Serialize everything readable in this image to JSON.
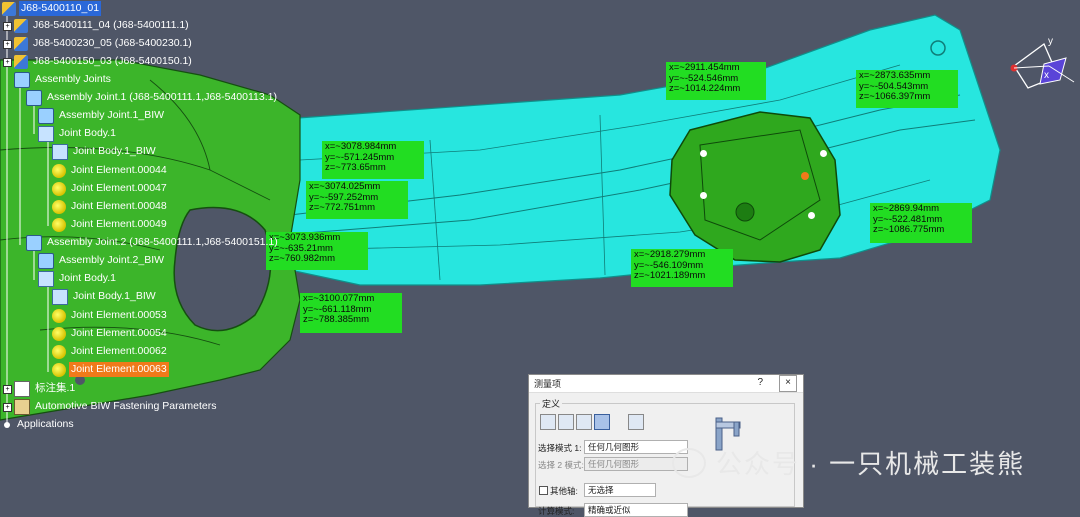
{
  "tree": {
    "root": "J68-5400110_01",
    "items": [
      {
        "label": "J68-5400111_04 (J68-5400111.1)"
      },
      {
        "label": "J68-5400230_05 (J68-5400230.1)"
      },
      {
        "label": "J68-5400150_03 (J68-5400150.1)"
      },
      {
        "label": "Assembly Joints"
      },
      {
        "label": "Assembly Joint.1 (J68-5400111.1,J68-5400113.1)"
      },
      {
        "label": "Assembly Joint.1_BIW"
      },
      {
        "label": "Joint Body.1"
      },
      {
        "label": "Joint Body.1_BIW"
      },
      {
        "label": "Joint Element.00044"
      },
      {
        "label": "Joint Element.00047"
      },
      {
        "label": "Joint Element.00048"
      },
      {
        "label": "Joint Element.00049"
      },
      {
        "label": "Assembly Joint.2 (J68-5400111.1,J68-5400151.1)"
      },
      {
        "label": "Assembly Joint.2_BIW"
      },
      {
        "label": "Joint Body.1"
      },
      {
        "label": "Joint Body.1_BIW"
      },
      {
        "label": "Joint Element.00053"
      },
      {
        "label": "Joint Element.00054"
      },
      {
        "label": "Joint Element.00062"
      },
      {
        "label": "Joint Element.00063"
      },
      {
        "label": "标注集.1"
      },
      {
        "label": "Automotive BIW Fastening Parameters"
      },
      {
        "label": "Applications"
      }
    ]
  },
  "measurements": [
    {
      "x": "x=~2911.454mm",
      "y": "y=~-524.546mm",
      "z": "z=~1014.224mm"
    },
    {
      "x": "x=~2873.635mm",
      "y": "y=~-504.543mm",
      "z": "z=~1066.397mm"
    },
    {
      "x": "x=~3078.984mm",
      "y": "y=~-571.245mm",
      "z": "z=~773.65mm"
    },
    {
      "x": "x=~3074.025mm",
      "y": "y=~-597.252mm",
      "z": "z=~772.751mm"
    },
    {
      "x": "x=~2869.94mm",
      "y": "y=~-522.481mm",
      "z": "z=~1086.775mm"
    },
    {
      "x": "x=~3073.936mm",
      "y": "y=~-635.21mm",
      "z": "z=~760.982mm"
    },
    {
      "x": "x=~2918.279mm",
      "y": "y=~-546.109mm",
      "z": "z=~1021.189mm"
    },
    {
      "x": "x=~3100.077mm",
      "y": "y=~-661.118mm",
      "z": "z=~788.385mm"
    }
  ],
  "dialog": {
    "title": "测量项",
    "help": "?",
    "close": "×",
    "group_label": "定义",
    "mode1_label": "选择模式 1:",
    "mode1_value": "任何几何图形",
    "mode2_label": "选择 2 模式:",
    "mode2_value": "任何几何图形",
    "other_axis_label": "其他轴:",
    "other_axis_value": "无选择",
    "calc_mode_label": "计算模式:",
    "calc_mode_value": "精确或近似"
  },
  "compass": {
    "y_label": "y",
    "x_label": "x"
  },
  "watermark": "公众号 · 一只机械工装熊",
  "colors": {
    "background": "#4f5667",
    "part_green": "#3cb52a",
    "part_cyan": "#27e6df",
    "label_green": "#22dd22",
    "selection_blue": "#2a68d9",
    "highlight_orange": "#f07a1a"
  }
}
